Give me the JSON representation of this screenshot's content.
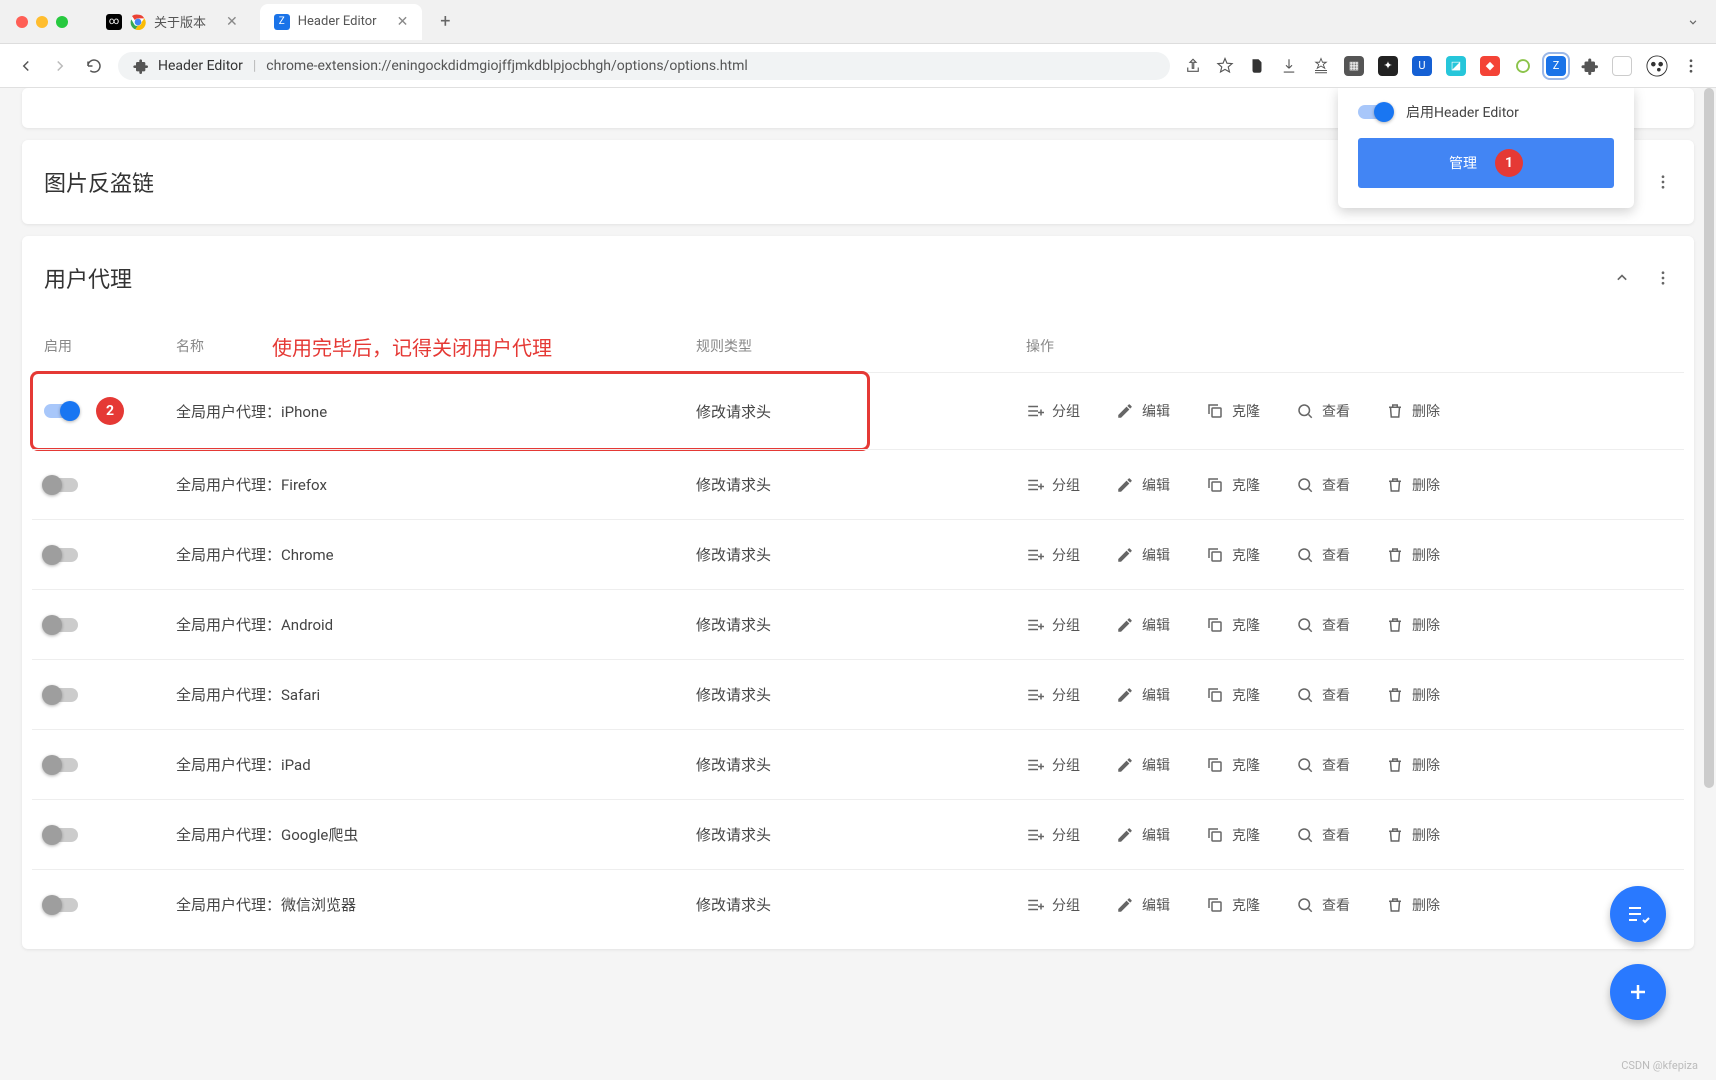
{
  "browser": {
    "tabs": [
      {
        "title": "关于版本",
        "favicon_bg": "linear-gradient(135deg,#4285f4,#ea4335,#fbbc05,#34a853)"
      },
      {
        "title": "Header Editor",
        "favicon_bg": "#1a73e8"
      }
    ],
    "url_label": "Header Editor",
    "url": "chrome-extension://eningockdidmgiojffjmkdblpjocbhgh/options/options.html"
  },
  "popup": {
    "enable_label": "启用Header Editor",
    "manage_label": "管理",
    "badge_1": "1"
  },
  "section1": {
    "title": "图片反盗链"
  },
  "section2": {
    "title": "用户代理",
    "annotation": "使用完毕后，记得关闭用户代理",
    "badge_2": "2",
    "headers": {
      "enable": "启用",
      "name": "名称",
      "type": "规则类型",
      "ops": "操作"
    },
    "ops": {
      "group": "分组",
      "edit": "编辑",
      "clone": "克隆",
      "view": "查看",
      "delete": "删除"
    },
    "rows": [
      {
        "enabled": true,
        "name": "全局用户代理：iPhone",
        "type": "修改请求头"
      },
      {
        "enabled": false,
        "name": "全局用户代理：Firefox",
        "type": "修改请求头"
      },
      {
        "enabled": false,
        "name": "全局用户代理：Chrome",
        "type": "修改请求头"
      },
      {
        "enabled": false,
        "name": "全局用户代理：Android",
        "type": "修改请求头"
      },
      {
        "enabled": false,
        "name": "全局用户代理：Safari",
        "type": "修改请求头"
      },
      {
        "enabled": false,
        "name": "全局用户代理：iPad",
        "type": "修改请求头"
      },
      {
        "enabled": false,
        "name": "全局用户代理：Google爬虫",
        "type": "修改请求头"
      },
      {
        "enabled": false,
        "name": "全局用户代理：微信浏览器",
        "type": "修改请求头"
      }
    ]
  },
  "watermark": "CSDN @kfepiza"
}
